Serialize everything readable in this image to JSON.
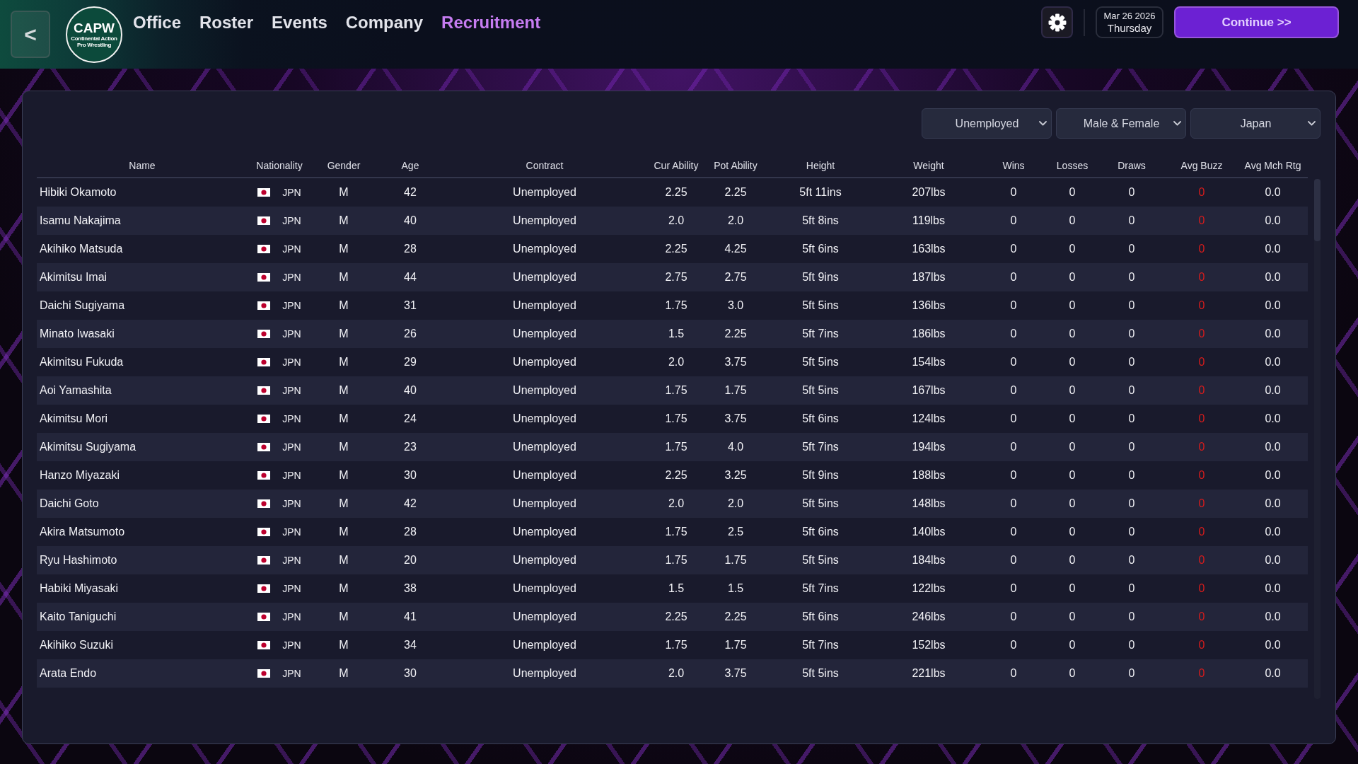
{
  "back_button": {
    "label": "<"
  },
  "logo": {
    "abbreviation": "CAPW",
    "subtitle": "Continental Action Pro Wrestling"
  },
  "nav": [
    {
      "label": "Office",
      "selected": false
    },
    {
      "label": "Roster",
      "selected": false
    },
    {
      "label": "Events",
      "selected": false
    },
    {
      "label": "Company",
      "selected": false
    },
    {
      "label": "Recruitment",
      "selected": true
    }
  ],
  "date": {
    "date": "Mar 26 2026",
    "weekday": "Thursday"
  },
  "continue_button": {
    "label": "Continue >>"
  },
  "filters": [
    {
      "value": "Unemployed"
    },
    {
      "value": "Male & Female"
    },
    {
      "value": "Japan"
    }
  ],
  "table": {
    "columns": [
      "Name",
      "Nationality",
      "Gender",
      "Age",
      "Contract",
      "Cur Ability",
      "Pot Ability",
      "Height",
      "Weight",
      "Wins",
      "Losses",
      "Draws",
      "Avg Buzz",
      "Avg Mch Rtg"
    ],
    "rows": [
      {
        "name": "Hibiki Okamoto",
        "nationality": "JPN",
        "gender": "M",
        "age": "42",
        "contract": "Unemployed",
        "cur_ability": "2.25",
        "pot_ability": "2.25",
        "height": "5ft 11ins",
        "weight": "207lbs",
        "wins": "0",
        "losses": "0",
        "draws": "0",
        "avg_buzz": "0",
        "avg_mch_rtg": "0.0"
      },
      {
        "name": "Isamu Nakajima",
        "nationality": "JPN",
        "gender": "M",
        "age": "40",
        "contract": "Unemployed",
        "cur_ability": "2.0",
        "pot_ability": "2.0",
        "height": "5ft 8ins",
        "weight": "119lbs",
        "wins": "0",
        "losses": "0",
        "draws": "0",
        "avg_buzz": "0",
        "avg_mch_rtg": "0.0"
      },
      {
        "name": "Akihiko Matsuda",
        "nationality": "JPN",
        "gender": "M",
        "age": "28",
        "contract": "Unemployed",
        "cur_ability": "2.25",
        "pot_ability": "4.25",
        "height": "5ft 6ins",
        "weight": "163lbs",
        "wins": "0",
        "losses": "0",
        "draws": "0",
        "avg_buzz": "0",
        "avg_mch_rtg": "0.0"
      },
      {
        "name": "Akimitsu Imai",
        "nationality": "JPN",
        "gender": "M",
        "age": "44",
        "contract": "Unemployed",
        "cur_ability": "2.75",
        "pot_ability": "2.75",
        "height": "5ft 9ins",
        "weight": "187lbs",
        "wins": "0",
        "losses": "0",
        "draws": "0",
        "avg_buzz": "0",
        "avg_mch_rtg": "0.0"
      },
      {
        "name": "Daichi Sugiyama",
        "nationality": "JPN",
        "gender": "M",
        "age": "31",
        "contract": "Unemployed",
        "cur_ability": "1.75",
        "pot_ability": "3.0",
        "height": "5ft 5ins",
        "weight": "136lbs",
        "wins": "0",
        "losses": "0",
        "draws": "0",
        "avg_buzz": "0",
        "avg_mch_rtg": "0.0"
      },
      {
        "name": "Minato Iwasaki",
        "nationality": "JPN",
        "gender": "M",
        "age": "26",
        "contract": "Unemployed",
        "cur_ability": "1.5",
        "pot_ability": "2.25",
        "height": "5ft 7ins",
        "weight": "186lbs",
        "wins": "0",
        "losses": "0",
        "draws": "0",
        "avg_buzz": "0",
        "avg_mch_rtg": "0.0"
      },
      {
        "name": "Akimitsu Fukuda",
        "nationality": "JPN",
        "gender": "M",
        "age": "29",
        "contract": "Unemployed",
        "cur_ability": "2.0",
        "pot_ability": "3.75",
        "height": "5ft 5ins",
        "weight": "154lbs",
        "wins": "0",
        "losses": "0",
        "draws": "0",
        "avg_buzz": "0",
        "avg_mch_rtg": "0.0"
      },
      {
        "name": "Aoi Yamashita",
        "nationality": "JPN",
        "gender": "M",
        "age": "40",
        "contract": "Unemployed",
        "cur_ability": "1.75",
        "pot_ability": "1.75",
        "height": "5ft 5ins",
        "weight": "167lbs",
        "wins": "0",
        "losses": "0",
        "draws": "0",
        "avg_buzz": "0",
        "avg_mch_rtg": "0.0"
      },
      {
        "name": "Akimitsu Mori",
        "nationality": "JPN",
        "gender": "M",
        "age": "24",
        "contract": "Unemployed",
        "cur_ability": "1.75",
        "pot_ability": "3.75",
        "height": "5ft 6ins",
        "weight": "124lbs",
        "wins": "0",
        "losses": "0",
        "draws": "0",
        "avg_buzz": "0",
        "avg_mch_rtg": "0.0"
      },
      {
        "name": "Akimitsu Sugiyama",
        "nationality": "JPN",
        "gender": "M",
        "age": "23",
        "contract": "Unemployed",
        "cur_ability": "1.75",
        "pot_ability": "4.0",
        "height": "5ft 7ins",
        "weight": "194lbs",
        "wins": "0",
        "losses": "0",
        "draws": "0",
        "avg_buzz": "0",
        "avg_mch_rtg": "0.0"
      },
      {
        "name": "Hanzo Miyazaki",
        "nationality": "JPN",
        "gender": "M",
        "age": "30",
        "contract": "Unemployed",
        "cur_ability": "2.25",
        "pot_ability": "3.25",
        "height": "5ft 9ins",
        "weight": "188lbs",
        "wins": "0",
        "losses": "0",
        "draws": "0",
        "avg_buzz": "0",
        "avg_mch_rtg": "0.0"
      },
      {
        "name": "Daichi Goto",
        "nationality": "JPN",
        "gender": "M",
        "age": "42",
        "contract": "Unemployed",
        "cur_ability": "2.0",
        "pot_ability": "2.0",
        "height": "5ft 5ins",
        "weight": "148lbs",
        "wins": "0",
        "losses": "0",
        "draws": "0",
        "avg_buzz": "0",
        "avg_mch_rtg": "0.0"
      },
      {
        "name": "Akira Matsumoto",
        "nationality": "JPN",
        "gender": "M",
        "age": "28",
        "contract": "Unemployed",
        "cur_ability": "1.75",
        "pot_ability": "2.5",
        "height": "5ft 6ins",
        "weight": "140lbs",
        "wins": "0",
        "losses": "0",
        "draws": "0",
        "avg_buzz": "0",
        "avg_mch_rtg": "0.0"
      },
      {
        "name": "Ryu Hashimoto",
        "nationality": "JPN",
        "gender": "M",
        "age": "20",
        "contract": "Unemployed",
        "cur_ability": "1.75",
        "pot_ability": "1.75",
        "height": "5ft 5ins",
        "weight": "184lbs",
        "wins": "0",
        "losses": "0",
        "draws": "0",
        "avg_buzz": "0",
        "avg_mch_rtg": "0.0"
      },
      {
        "name": "Habiki Miyasaki",
        "nationality": "JPN",
        "gender": "M",
        "age": "38",
        "contract": "Unemployed",
        "cur_ability": "1.5",
        "pot_ability": "1.5",
        "height": "5ft 7ins",
        "weight": "122lbs",
        "wins": "0",
        "losses": "0",
        "draws": "0",
        "avg_buzz": "0",
        "avg_mch_rtg": "0.0"
      },
      {
        "name": "Kaito Taniguchi",
        "nationality": "JPN",
        "gender": "M",
        "age": "41",
        "contract": "Unemployed",
        "cur_ability": "2.25",
        "pot_ability": "2.25",
        "height": "5ft 6ins",
        "weight": "246lbs",
        "wins": "0",
        "losses": "0",
        "draws": "0",
        "avg_buzz": "0",
        "avg_mch_rtg": "0.0"
      },
      {
        "name": "Akihiko Suzuki",
        "nationality": "JPN",
        "gender": "M",
        "age": "34",
        "contract": "Unemployed",
        "cur_ability": "1.75",
        "pot_ability": "1.75",
        "height": "5ft 7ins",
        "weight": "152lbs",
        "wins": "0",
        "losses": "0",
        "draws": "0",
        "avg_buzz": "0",
        "avg_mch_rtg": "0.0"
      },
      {
        "name": "Arata Endo",
        "nationality": "JPN",
        "gender": "M",
        "age": "30",
        "contract": "Unemployed",
        "cur_ability": "2.0",
        "pot_ability": "3.75",
        "height": "5ft 5ins",
        "weight": "221lbs",
        "wins": "0",
        "losses": "0",
        "draws": "0",
        "avg_buzz": "0",
        "avg_mch_rtg": "0.0"
      }
    ]
  }
}
